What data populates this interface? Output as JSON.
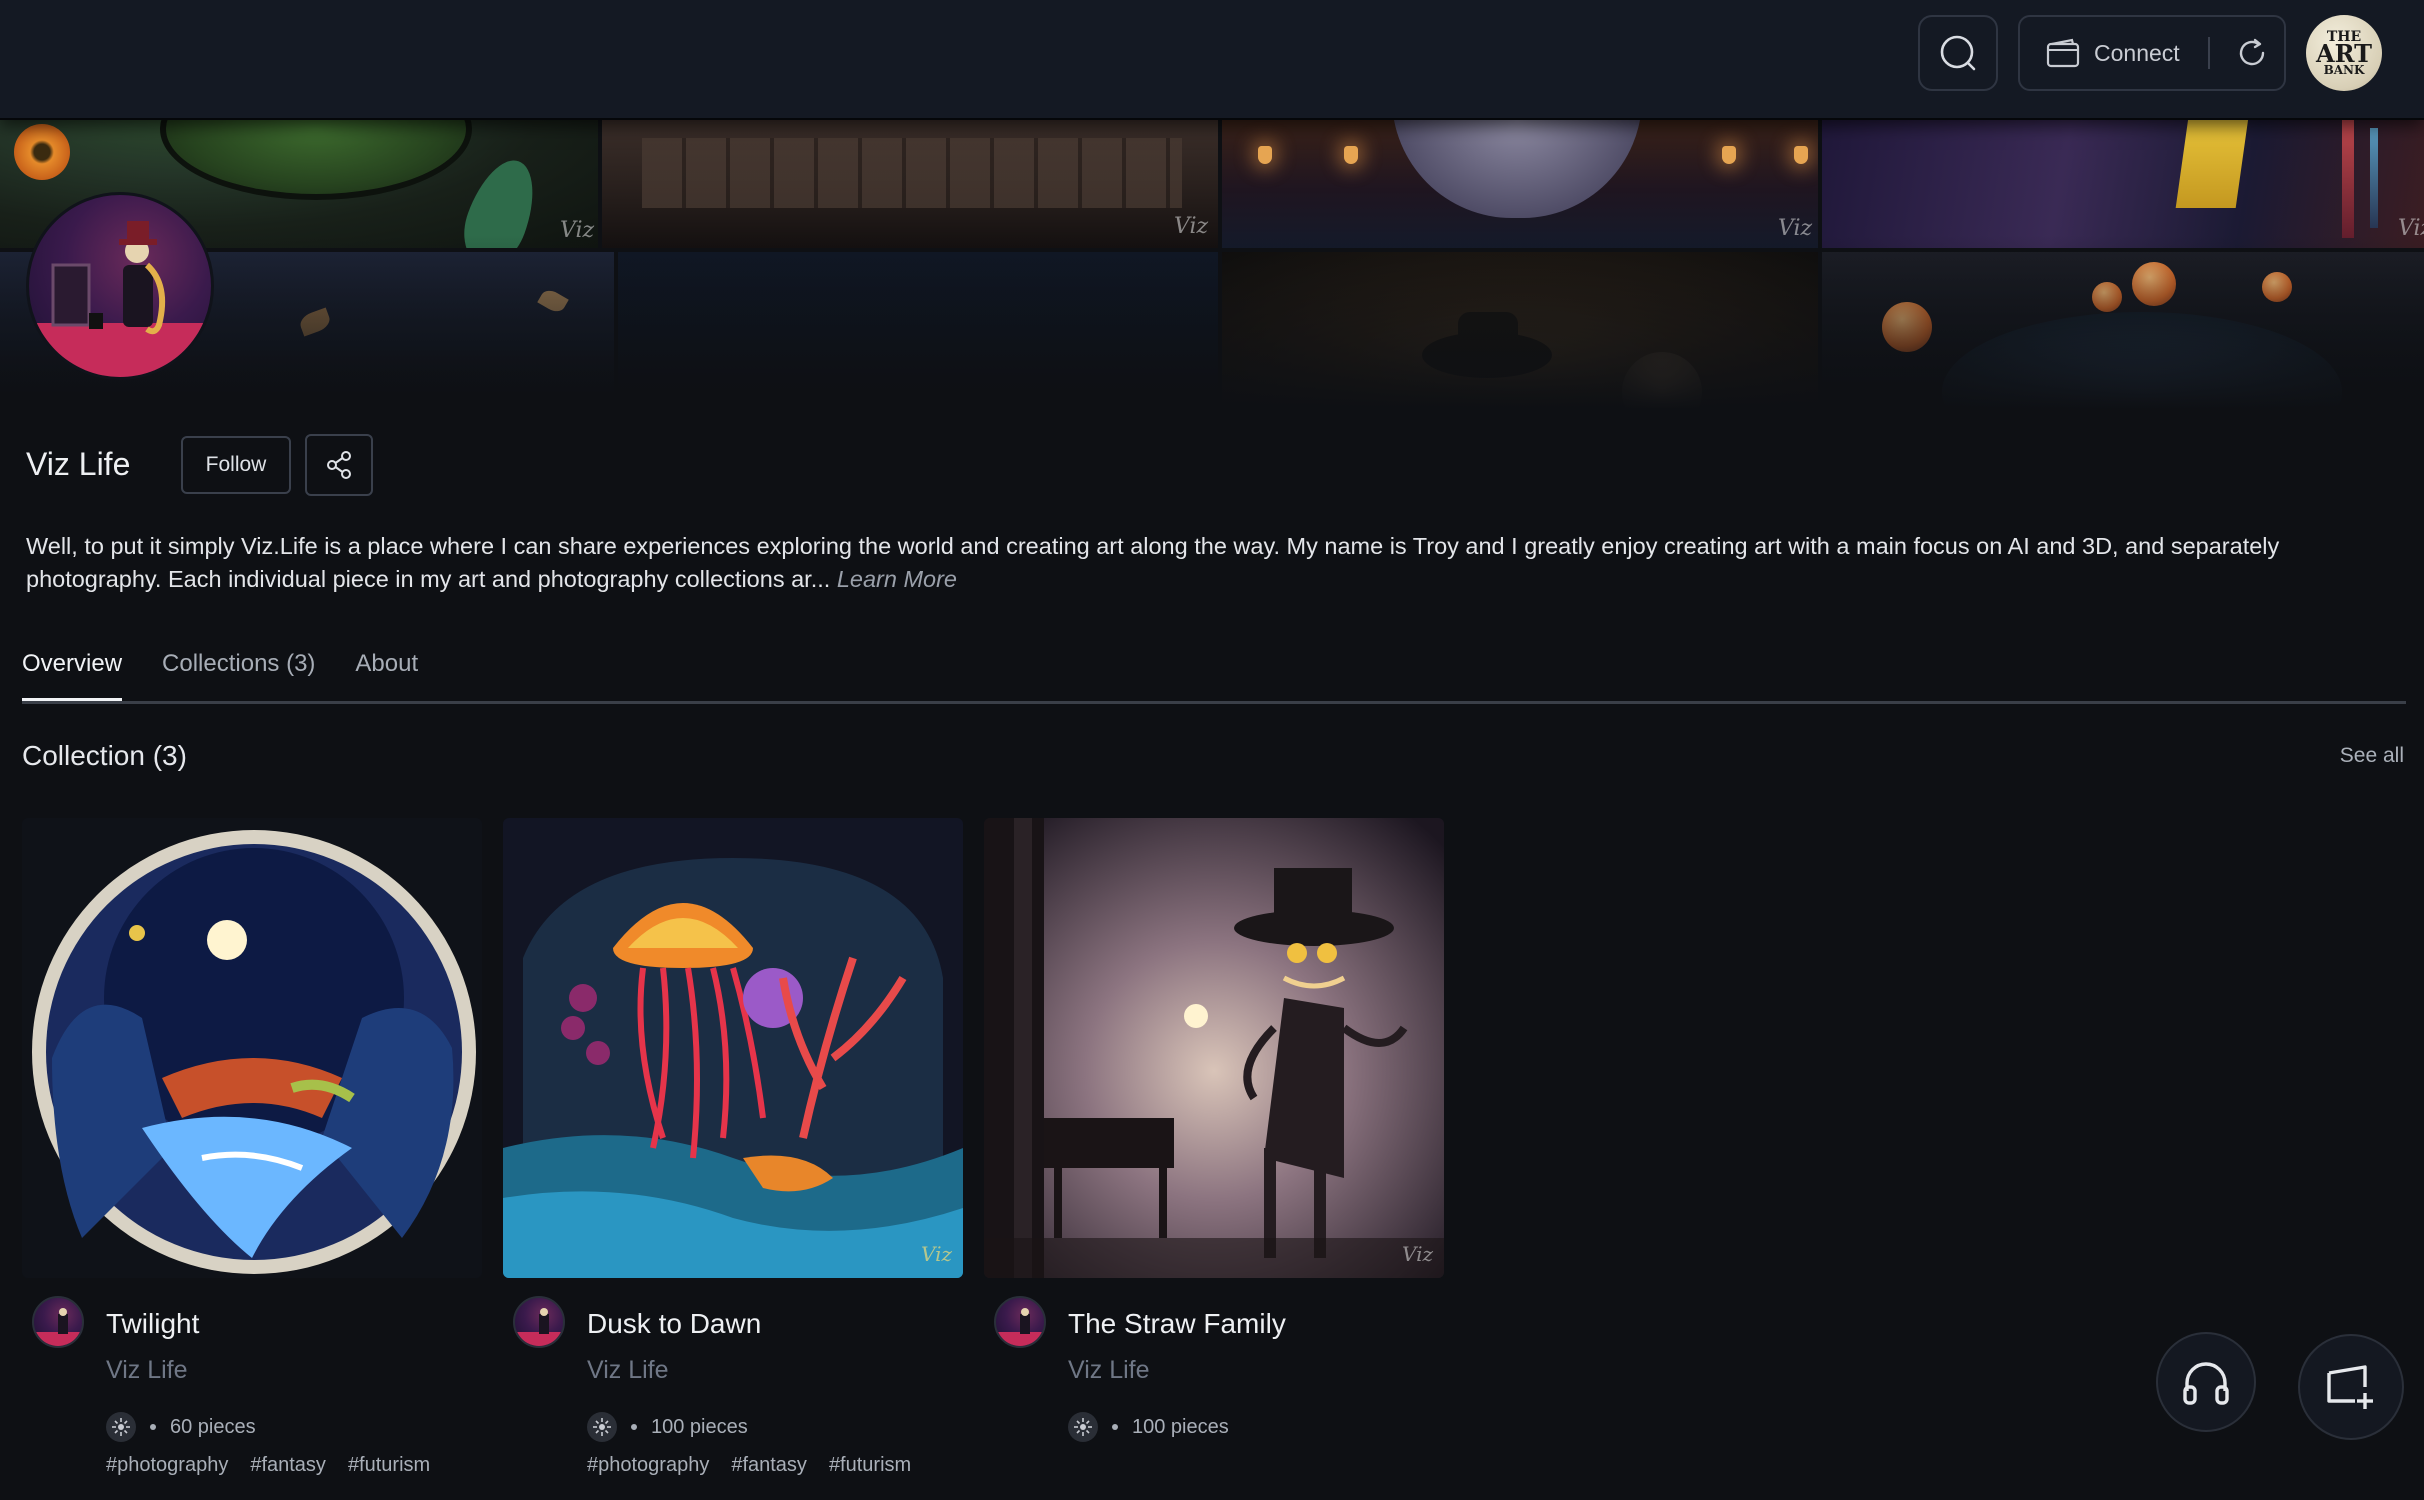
{
  "topbar": {
    "search_icon": "search-icon",
    "connect_label": "Connect",
    "wallet_icon": "wallet-icon",
    "refresh_icon": "refresh-icon",
    "logo": {
      "line1": "THE",
      "line2": "ART",
      "line3": "BANK"
    }
  },
  "profile": {
    "name": "Viz Life",
    "follow_label": "Follow",
    "share_icon": "share-icon",
    "bio": "Well, to put it simply Viz.Life is a place where I can share experiences exploring the world and creating art along the way. My name is Troy and I greatly enjoy creating art with a main focus on AI and 3D, and separately photography. Each individual piece in my art and photography collections ar...",
    "learn_more": "Learn More"
  },
  "tabs": [
    {
      "label": "Overview",
      "active": true
    },
    {
      "label": "Collections (3)",
      "active": false
    },
    {
      "label": "About",
      "active": false
    }
  ],
  "collection_section": {
    "title": "Collection (3)",
    "see_all": "See all"
  },
  "collections": [
    {
      "title": "Twilight",
      "author": "Viz Life",
      "pieces": "60 pieces",
      "tags": [
        "#photography",
        "#fantasy",
        "#futurism"
      ]
    },
    {
      "title": "Dusk to Dawn",
      "author": "Viz Life",
      "pieces": "100 pieces",
      "tags": [
        "#photography",
        "#fantasy",
        "#futurism"
      ]
    },
    {
      "title": "The Straw Family",
      "author": "Viz Life",
      "pieces": "100 pieces",
      "tags": []
    }
  ],
  "watermark": "Viz",
  "fabs": {
    "audio_icon": "headphones-icon",
    "add_icon": "add-screen-icon"
  },
  "colors": {
    "background": "#0e1014",
    "topbar": "#141923",
    "muted_text": "#6f7786"
  }
}
